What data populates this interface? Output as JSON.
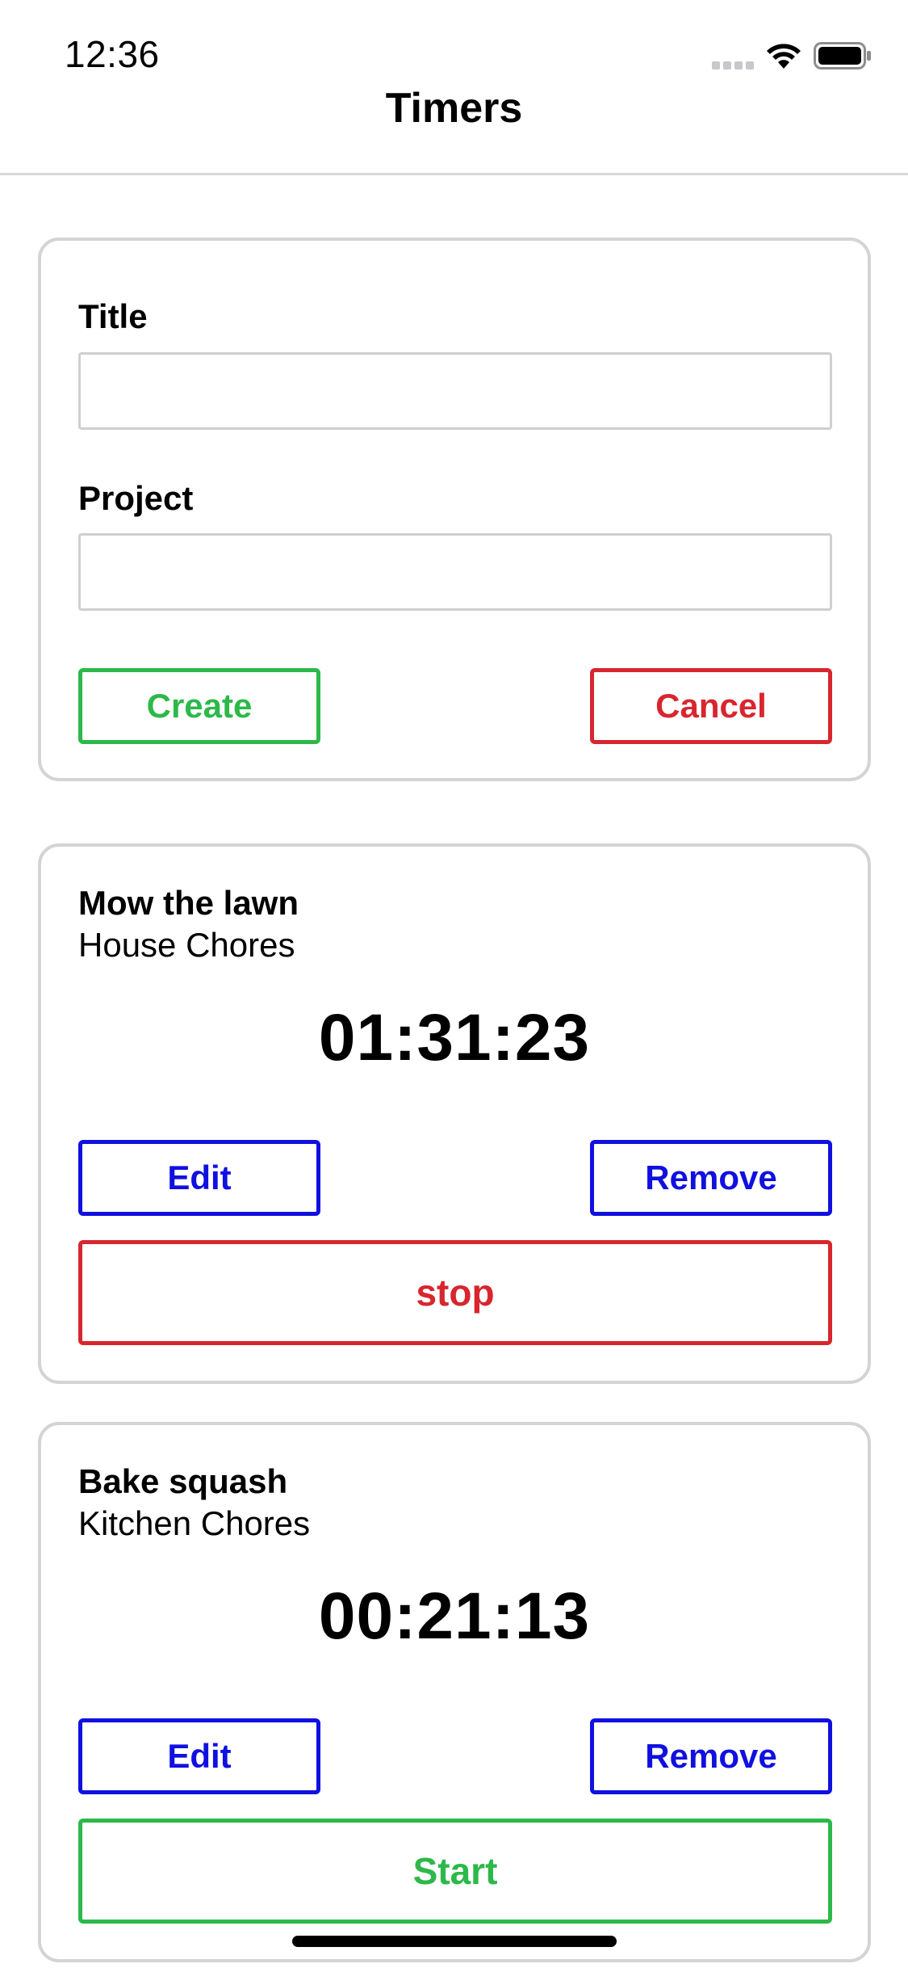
{
  "status_bar": {
    "time": "12:36",
    "icons": [
      "cellular-signal-icon",
      "wifi-icon",
      "battery-icon"
    ]
  },
  "nav": {
    "title": "Timers"
  },
  "form": {
    "title_label": "Title",
    "title_value": "",
    "project_label": "Project",
    "project_value": "",
    "create_label": "Create",
    "cancel_label": "Cancel"
  },
  "timers": [
    {
      "title": "Mow the lawn",
      "project": "House Chores",
      "elapsed": "01:31:23",
      "edit_label": "Edit",
      "remove_label": "Remove",
      "action_label": "stop",
      "action_color": "#d8262e"
    },
    {
      "title": "Bake squash",
      "project": "Kitchen Chores",
      "elapsed": "00:21:13",
      "edit_label": "Edit",
      "remove_label": "Remove",
      "action_label": "Start",
      "action_color": "#2db84a"
    }
  ],
  "colors": {
    "create": "#2db84a",
    "cancel": "#d8262e",
    "edit_remove": "#1010e0",
    "card_border": "#d4d4d4"
  }
}
